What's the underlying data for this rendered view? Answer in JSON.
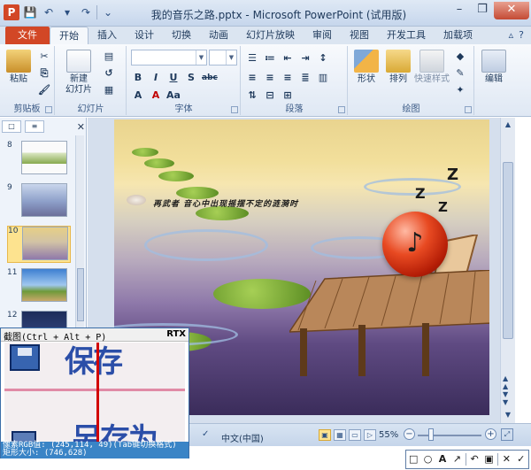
{
  "window": {
    "title": "我的音乐之路.pptx - Microsoft PowerPoint (试用版)",
    "app_icon": "P"
  },
  "qat": {
    "save_icon": "💾",
    "undo_icon": "↶",
    "redo_icon": "↷"
  },
  "tabs": [
    {
      "label": "文件"
    },
    {
      "label": "开始"
    },
    {
      "label": "插入"
    },
    {
      "label": "设计"
    },
    {
      "label": "切换"
    },
    {
      "label": "动画"
    },
    {
      "label": "幻灯片放映"
    },
    {
      "label": "审阅"
    },
    {
      "label": "视图"
    },
    {
      "label": "开发工具"
    },
    {
      "label": "加载项"
    }
  ],
  "ribbon": {
    "clipboard": {
      "label": "剪贴板",
      "paste": "粘贴"
    },
    "slides": {
      "label": "幻灯片",
      "new_slide_line1": "新建",
      "new_slide_line2": "幻灯片"
    },
    "font": {
      "label": "字体"
    },
    "paragraph": {
      "label": "段落"
    },
    "drawing": {
      "label": "绘图",
      "shapes": "形状",
      "arrange": "排列",
      "quick_styles": "快速样式"
    },
    "editing": {
      "label": "编辑"
    }
  },
  "thumbnails": [
    {
      "num": "8"
    },
    {
      "num": "9"
    },
    {
      "num": "10"
    },
    {
      "num": "11"
    },
    {
      "num": "12"
    }
  ],
  "slide": {
    "caption": "再武者 音心中出现摇摆不定的涟漪时"
  },
  "statusbar": {
    "language": "中文(中国)",
    "zoom": "55%"
  },
  "capture": {
    "title": "截图(Ctrl + Alt + P)",
    "rtx": "RTX",
    "zoom_text1": "保存",
    "zoom_text2": "另存为",
    "pixel_rgb": "像素RGB值: (245,114, 49)(Tab键切换格式)",
    "rect_size": "矩形大小: (746,628)"
  },
  "colors": {
    "file_tab": "#d24726",
    "ribbon_bg": "#dfe8f4",
    "capture_info_bg": "#3a84c6",
    "crosshair": "#d20000"
  }
}
